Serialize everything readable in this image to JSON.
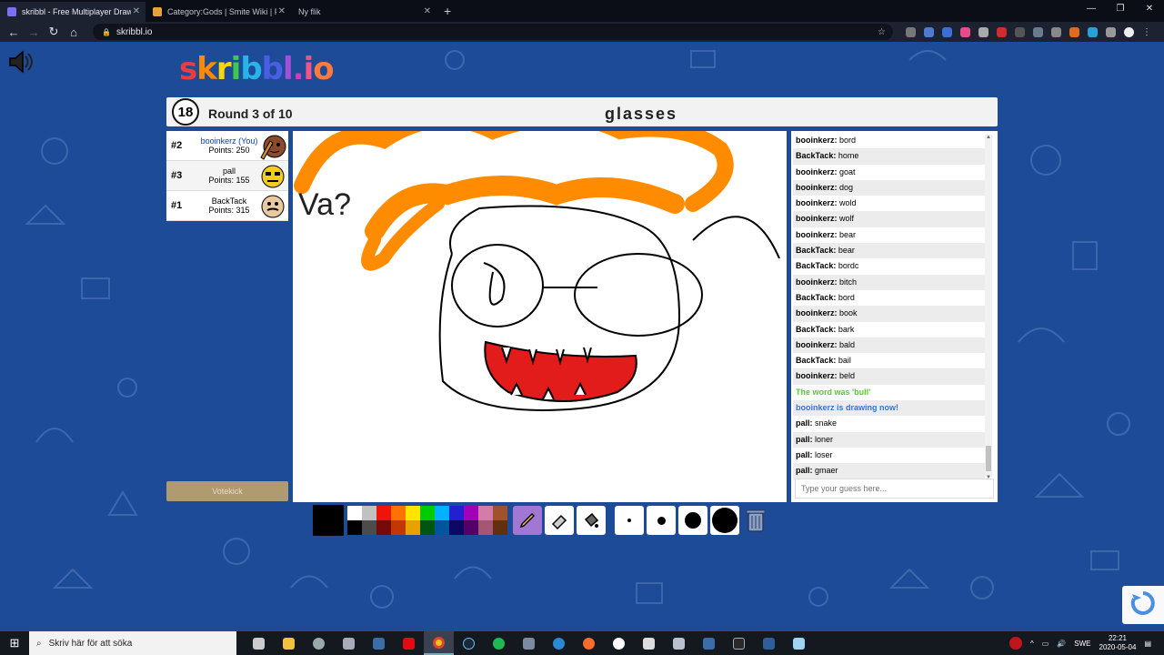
{
  "browser": {
    "tabs": [
      {
        "title": "skribbl - Free Multiplayer Drawin",
        "active": true
      },
      {
        "title": "Category:Gods | Smite Wiki | Fan",
        "active": false
      },
      {
        "title": "Ny flik",
        "active": false
      }
    ],
    "url": "skribbl.io"
  },
  "game": {
    "logo": "skribbl.io",
    "timer": "18",
    "round_label": "Round 3 of 10",
    "word": "glasses",
    "players": [
      {
        "rank": "#2",
        "name": "booinkerz (You)",
        "points": "Points: 250",
        "me": true
      },
      {
        "rank": "#3",
        "name": "pall",
        "points": "Points: 155",
        "me": false
      },
      {
        "rank": "#1",
        "name": "BackTack",
        "points": "Points: 315",
        "me": false
      }
    ],
    "canvas_text": "Va?",
    "votekick_label": "Votekick",
    "chat": [
      {
        "author": "booinkerz",
        "text": "bord"
      },
      {
        "author": "BackTack",
        "text": "home"
      },
      {
        "author": "booinkerz",
        "text": "goat"
      },
      {
        "author": "booinkerz",
        "text": "dog"
      },
      {
        "author": "booinkerz",
        "text": "wold"
      },
      {
        "author": "booinkerz",
        "text": "wolf"
      },
      {
        "author": "booinkerz",
        "text": "bear"
      },
      {
        "author": "BackTack",
        "text": "bear"
      },
      {
        "author": "BackTack",
        "text": "bordc"
      },
      {
        "author": "booinkerz",
        "text": "bitch"
      },
      {
        "author": "BackTack",
        "text": "bord"
      },
      {
        "author": "booinkerz",
        "text": "book"
      },
      {
        "author": "BackTack",
        "text": "bark"
      },
      {
        "author": "booinkerz",
        "text": "bald"
      },
      {
        "author": "BackTack",
        "text": "bail"
      },
      {
        "author": "booinkerz",
        "text": "beld"
      },
      {
        "system": "The word was 'bull'",
        "style": "green"
      },
      {
        "system": "booinkerz is drawing now!",
        "style": "blue"
      },
      {
        "author": "pall",
        "text": "snake"
      },
      {
        "author": "pall",
        "text": "loner"
      },
      {
        "author": "pall",
        "text": "loser"
      },
      {
        "author": "pall",
        "text": "gmaer"
      }
    ],
    "guess_placeholder": "Type your guess here...",
    "palette_top": [
      "#ffffff",
      "#c1c1c1",
      "#ef130b",
      "#ff7100",
      "#ffe400",
      "#00cc00",
      "#00b2ff",
      "#231fd3",
      "#a300ba",
      "#d37caa",
      "#a0522d"
    ],
    "palette_bottom": [
      "#000000",
      "#4c4c4c",
      "#740b07",
      "#c23800",
      "#e8a200",
      "#005510",
      "#00569e",
      "#0e0865",
      "#550069",
      "#a75574",
      "#63300d"
    ],
    "current_color": "#000000"
  },
  "taskbar": {
    "search_placeholder": "Skriv här för att söka",
    "language": "SWE",
    "time": "22:21",
    "date": "2020-05-04"
  }
}
